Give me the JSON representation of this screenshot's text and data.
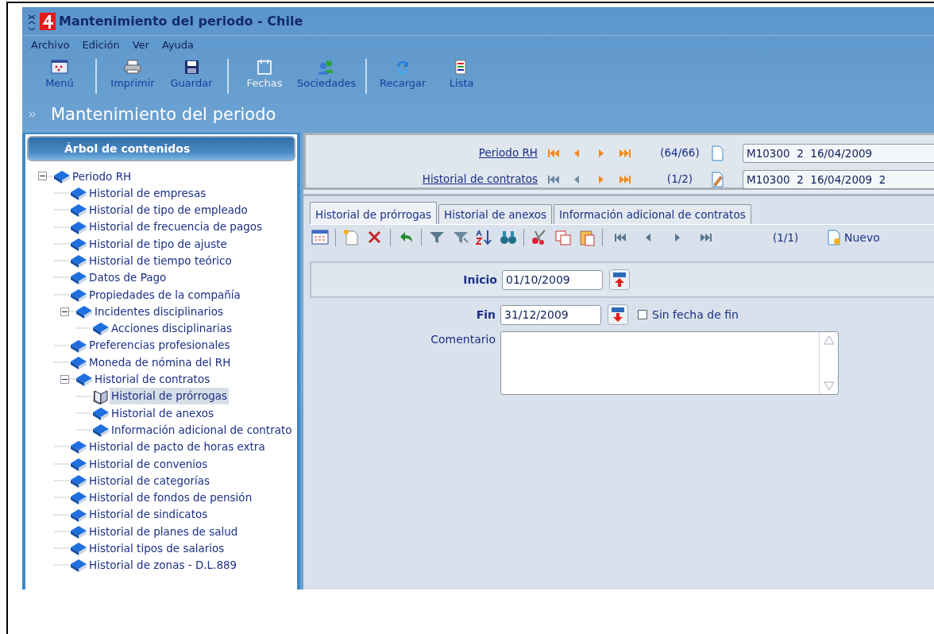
{
  "window": {
    "title": "Mantenimiento del periodo - Chile"
  },
  "menu": [
    {
      "label": "Archivo"
    },
    {
      "label": "Edición"
    },
    {
      "label": "Ver"
    },
    {
      "label": "Ayuda"
    }
  ],
  "toolbar": {
    "groups": [
      {
        "buttons": [
          {
            "label": "Menú",
            "disabled": false
          }
        ]
      },
      {
        "buttons": [
          {
            "label": "Imprimir",
            "disabled": false
          },
          {
            "label": "Guardar",
            "disabled": false
          }
        ]
      },
      {
        "buttons": [
          {
            "label": "Fechas",
            "disabled": true
          },
          {
            "label": "Sociedades",
            "disabled": false
          }
        ]
      },
      {
        "buttons": [
          {
            "label": "Recargar",
            "disabled": false
          },
          {
            "label": "Lista",
            "disabled": false
          }
        ]
      }
    ]
  },
  "heading": "Mantenimiento del periodo",
  "sidebar": {
    "title": "Árbol de contenidos",
    "tree": [
      {
        "label": "Periodo RH",
        "selected": false,
        "expanded": true,
        "children": [
          {
            "label": "Historial de empresas",
            "selected": false
          },
          {
            "label": "Historial de tipo de empleado",
            "selected": false
          },
          {
            "label": "Historial de frecuencia de pagos",
            "selected": false
          },
          {
            "label": "Historial de tipo de ajuste",
            "selected": false
          },
          {
            "label": "Historial de tiempo teórico",
            "selected": false
          },
          {
            "label": "Datos de Pago",
            "selected": false
          },
          {
            "label": "Propiedades de la compañía",
            "selected": false
          },
          {
            "label": "Incidentes disciplinarios",
            "selected": false,
            "expanded": true,
            "children": [
              {
                "label": "Acciones disciplinarias",
                "selected": false
              }
            ]
          },
          {
            "label": "Preferencias profesionales",
            "selected": false
          },
          {
            "label": "Moneda de nómina del RH",
            "selected": false
          },
          {
            "label": "Historial de contratos",
            "selected": false,
            "expanded": true,
            "children": [
              {
                "label": "Historial de prórrogas",
                "selected": true
              },
              {
                "label": "Historial de anexos",
                "selected": false
              },
              {
                "label": "Información adicional de contrato",
                "selected": false
              }
            ]
          },
          {
            "label": "Historial de pacto de horas extra",
            "selected": false
          },
          {
            "label": "Historial de convenios",
            "selected": false
          },
          {
            "label": "Historial de categorías",
            "selected": false
          },
          {
            "label": "Historial de fondos de pensión",
            "selected": false
          },
          {
            "label": "Historial de sindicatos",
            "selected": false
          },
          {
            "label": "Historial de planes de salud",
            "selected": false
          },
          {
            "label": "Historial tipos de salarios",
            "selected": false
          },
          {
            "label": "Historial de zonas - D.L.889",
            "selected": false
          }
        ]
      }
    ]
  },
  "navigators": [
    {
      "link": "Periodo RH",
      "count": "(64/66)",
      "value": "M10300  2  16/04/2009",
      "buttons": [
        {
          "disabled": false
        },
        {
          "disabled": false
        },
        {
          "disabled": false
        },
        {
          "disabled": false
        }
      ]
    },
    {
      "link": "Historial de contratos",
      "count": "(1/2)",
      "value": "M10300  2  16/04/2009  2",
      "buttons": [
        {
          "disabled": true
        },
        {
          "disabled": true
        },
        {
          "disabled": false
        },
        {
          "disabled": false
        }
      ]
    }
  ],
  "tabs": [
    {
      "label": "Historial de prórrogas",
      "selected": true
    },
    {
      "label": "Historial de anexos",
      "selected": false
    },
    {
      "label": "Información adicional de contratos",
      "selected": false
    }
  ],
  "record_toolbar": {
    "count": "(1/1)",
    "new_button": "Nuevo"
  },
  "form": {
    "start": {
      "label": "Inicio",
      "value": "01/10/2009"
    },
    "end": {
      "label": "Fin",
      "value": "31/12/2009"
    },
    "no_end": {
      "label": "Sin fecha de fin",
      "checked": false
    },
    "comment": {
      "label": "Comentario"
    }
  }
}
